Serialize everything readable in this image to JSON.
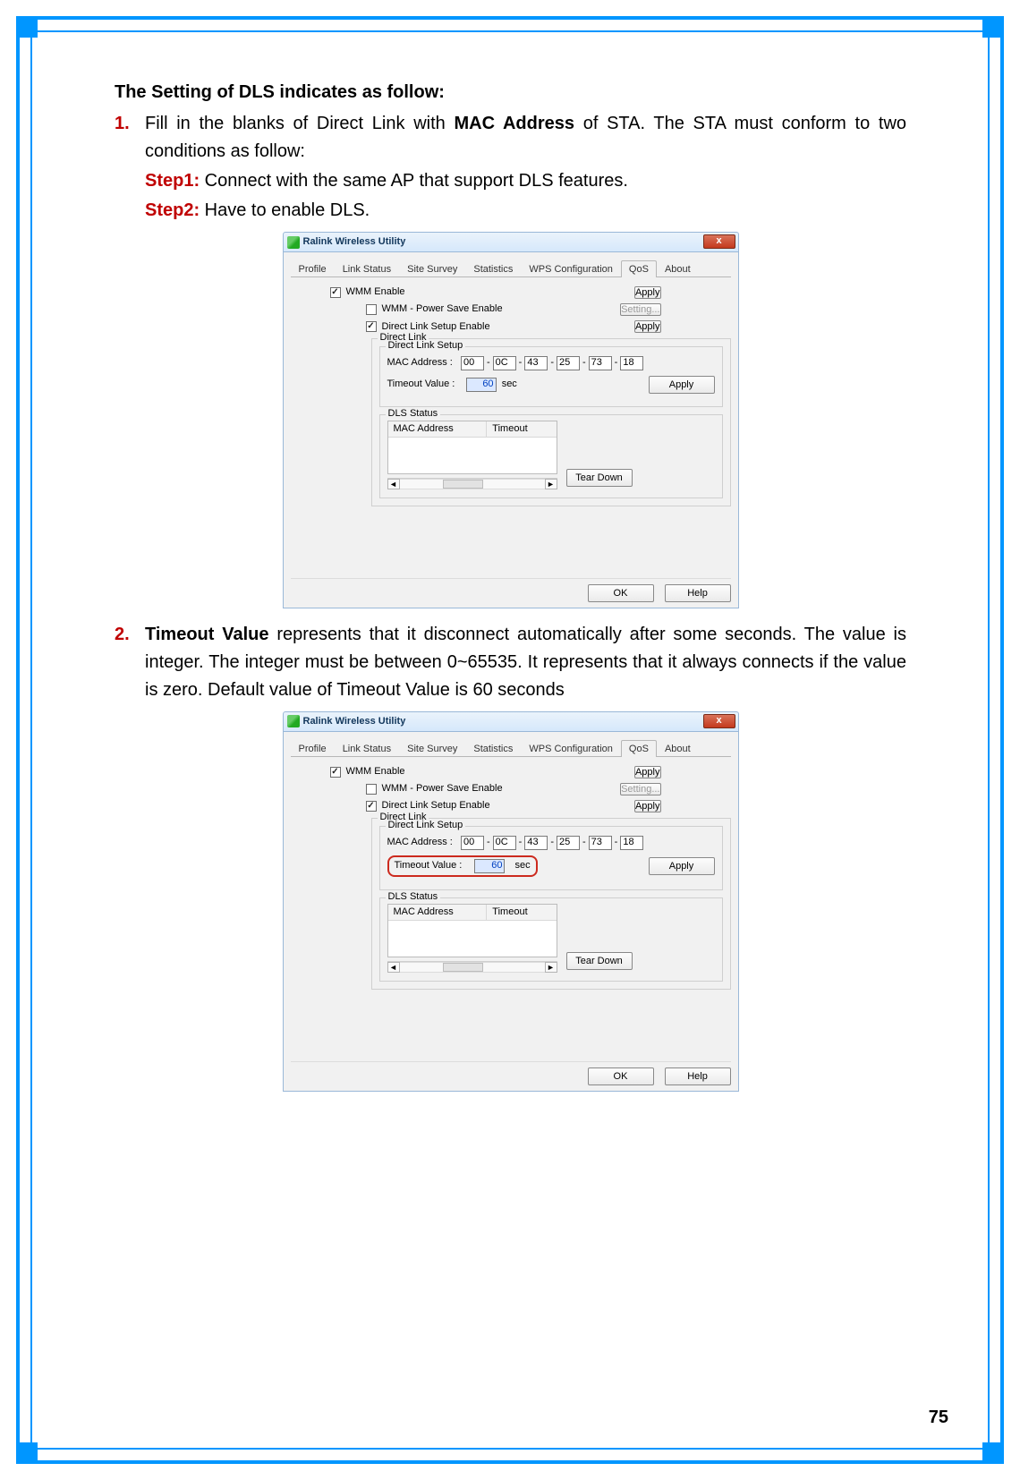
{
  "page_number": "75",
  "heading": "The Setting of DLS indicates as follow:",
  "list": [
    {
      "num": "1.",
      "body_parts": [
        "Fill in the blanks of Direct Link with ",
        "MAC Address",
        " of STA. The STA must conform to two conditions as follow:"
      ],
      "steps": [
        {
          "label": "Step1:",
          "text": " Connect with the same AP that support DLS features."
        },
        {
          "label": "Step2:",
          "text": " Have to enable DLS."
        }
      ]
    },
    {
      "num": "2.",
      "body_parts": [
        "Timeout Value",
        " represents that it disconnect automatically after some seconds. The value is integer. The integer must be between 0~65535. It represents that it always connects if the value is zero. Default value of Timeout Value is 60 seconds"
      ]
    }
  ],
  "dialog": {
    "title": "Ralink Wireless Utility",
    "close": "x",
    "tabs": [
      "Profile",
      "Link Status",
      "Site Survey",
      "Statistics",
      "WPS Configuration",
      "QoS",
      "About"
    ],
    "active_tab_index": 5,
    "wmm_enable": {
      "label": "WMM Enable",
      "checked": true
    },
    "wmm_ps": {
      "label": "WMM - Power Save Enable",
      "checked": false
    },
    "dls_enable": {
      "label": "Direct Link Setup Enable",
      "checked": true
    },
    "buttons": {
      "apply": "Apply",
      "setting": "Setting...",
      "teardown": "Tear Down",
      "ok": "OK",
      "help": "Help"
    },
    "direct_link_legend": "Direct Link",
    "dls_setup_legend": "Direct Link Setup",
    "mac_label": "MAC Address :",
    "mac": [
      "00",
      "0C",
      "43",
      "25",
      "73",
      "18"
    ],
    "mac_sep": "-",
    "timeout_label": "Timeout Value :",
    "timeout_value": "60",
    "timeout_unit": "sec",
    "dls_status_legend": "DLS Status",
    "table_headers": [
      "MAC Address",
      "Timeout"
    ]
  },
  "dialog2_highlight_timeout": true
}
